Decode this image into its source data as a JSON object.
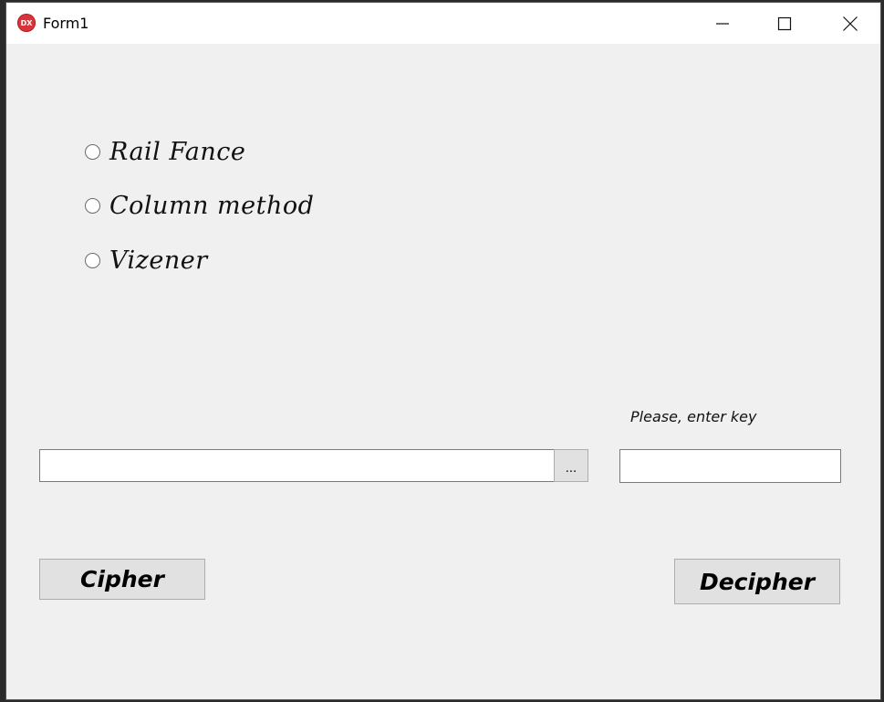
{
  "window": {
    "title": "Form1",
    "app_icon_text": "DX",
    "icons": {
      "minimize": "minimize-icon",
      "maximize": "maximize-icon",
      "close": "close-icon"
    }
  },
  "options": {
    "items": [
      {
        "label": "Rail Fance",
        "selected": false
      },
      {
        "label": "Column method",
        "selected": false
      },
      {
        "label": "Vizener",
        "selected": false
      }
    ]
  },
  "file": {
    "value": "",
    "browse_label": "..."
  },
  "key": {
    "label": "Please, enter key",
    "value": ""
  },
  "actions": {
    "cipher_label": "Cipher",
    "decipher_label": "Decipher"
  }
}
